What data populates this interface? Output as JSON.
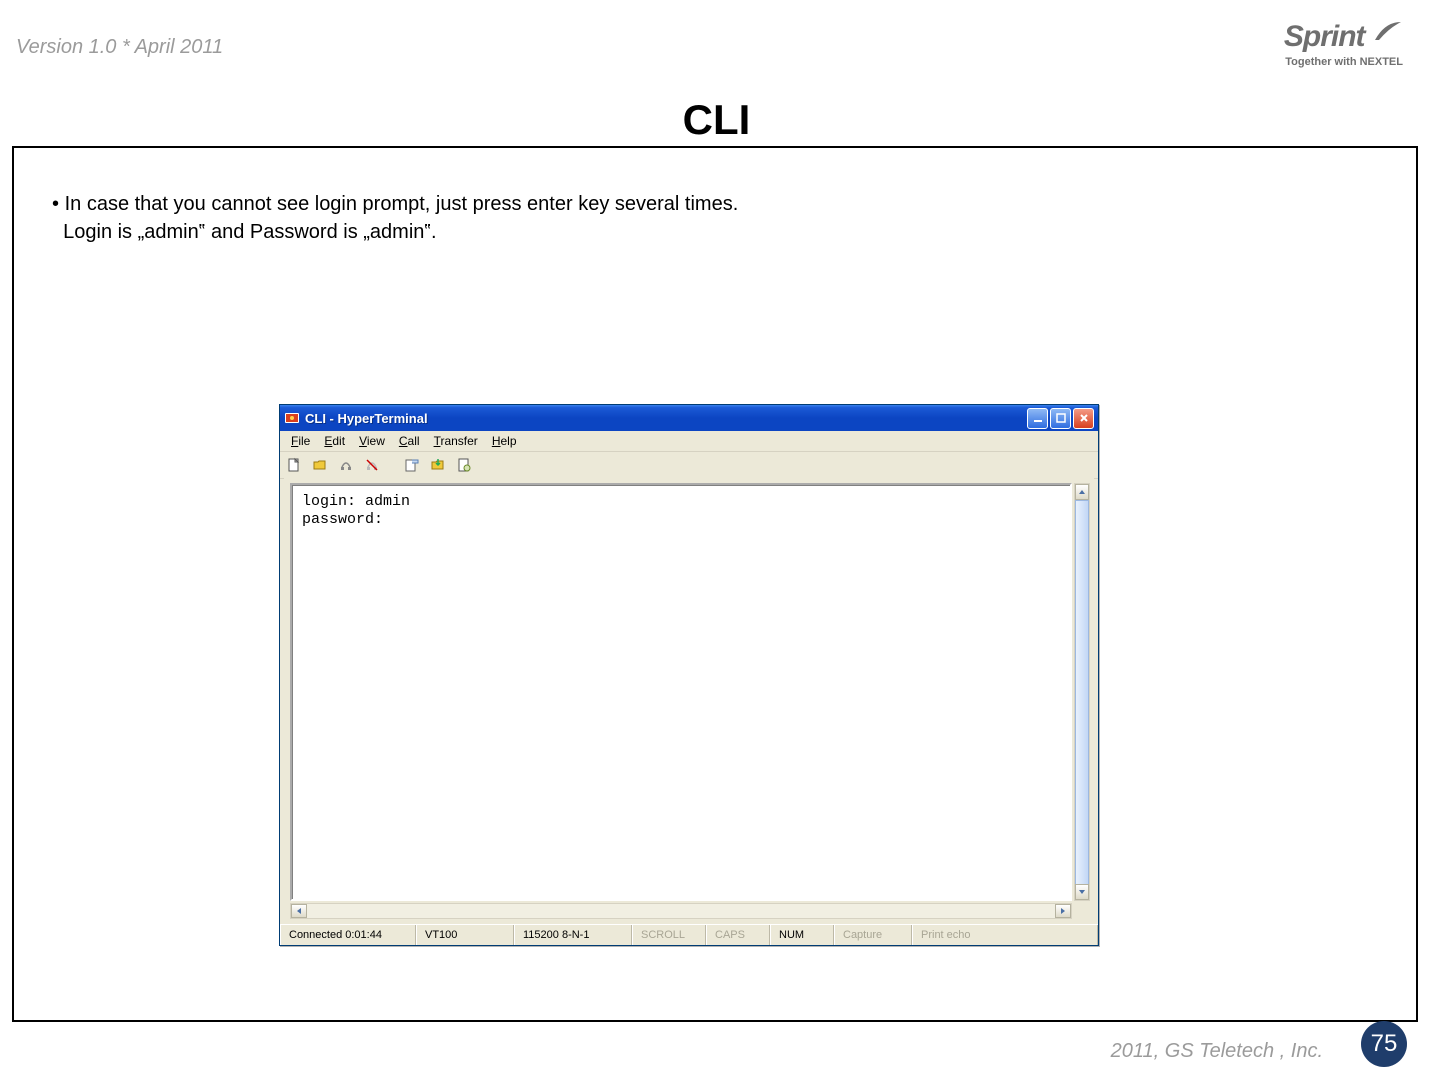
{
  "header": {
    "version_text": "Version 1.0 * April 2011",
    "brand_name": "Sprint",
    "brand_tag": "Together with NEXTEL"
  },
  "title": "CLI",
  "instruction": {
    "bullet": "•",
    "line1": "In case that you cannot see login prompt, just press enter key several times.",
    "line2": "Login is „admin‟ and Password is „admin‟."
  },
  "hyperterminal": {
    "window_title": "CLI - HyperTerminal",
    "menu": {
      "file": "File",
      "edit": "Edit",
      "view": "View",
      "call": "Call",
      "transfer": "Transfer",
      "help": "Help"
    },
    "terminal_text": "login: admin\npassword:",
    "status": {
      "connected": "Connected 0:01:44",
      "emulation": "VT100",
      "settings": "115200 8-N-1",
      "scroll": "SCROLL",
      "caps": "CAPS",
      "num": "NUM",
      "capture": "Capture",
      "printecho": "Print echo"
    }
  },
  "footer": {
    "copyright": "2011, GS Teletech , Inc.",
    "page_number": "75"
  }
}
